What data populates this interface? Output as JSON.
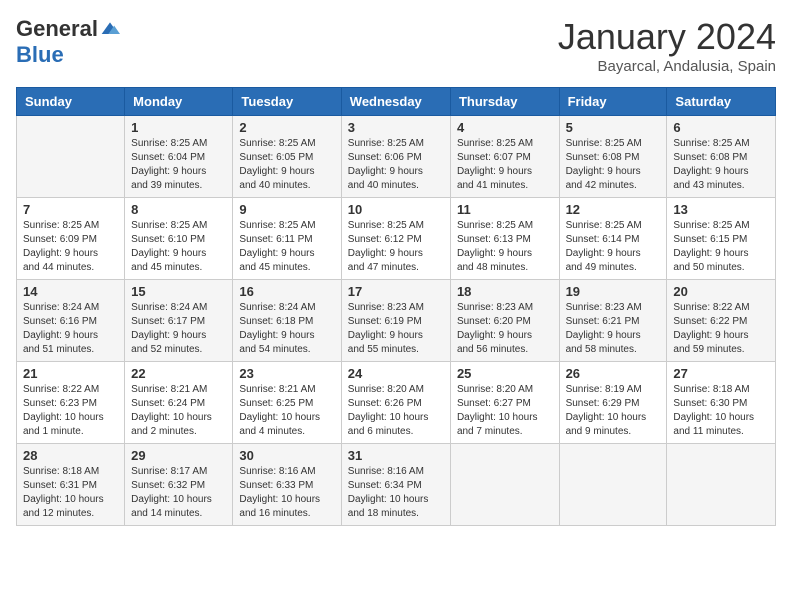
{
  "logo": {
    "general": "General",
    "blue": "Blue"
  },
  "header": {
    "month": "January 2024",
    "location": "Bayarcal, Andalusia, Spain"
  },
  "weekdays": [
    "Sunday",
    "Monday",
    "Tuesday",
    "Wednesday",
    "Thursday",
    "Friday",
    "Saturday"
  ],
  "weeks": [
    [
      {
        "day": "",
        "info": ""
      },
      {
        "day": "1",
        "info": "Sunrise: 8:25 AM\nSunset: 6:04 PM\nDaylight: 9 hours\nand 39 minutes."
      },
      {
        "day": "2",
        "info": "Sunrise: 8:25 AM\nSunset: 6:05 PM\nDaylight: 9 hours\nand 40 minutes."
      },
      {
        "day": "3",
        "info": "Sunrise: 8:25 AM\nSunset: 6:06 PM\nDaylight: 9 hours\nand 40 minutes."
      },
      {
        "day": "4",
        "info": "Sunrise: 8:25 AM\nSunset: 6:07 PM\nDaylight: 9 hours\nand 41 minutes."
      },
      {
        "day": "5",
        "info": "Sunrise: 8:25 AM\nSunset: 6:08 PM\nDaylight: 9 hours\nand 42 minutes."
      },
      {
        "day": "6",
        "info": "Sunrise: 8:25 AM\nSunset: 6:08 PM\nDaylight: 9 hours\nand 43 minutes."
      }
    ],
    [
      {
        "day": "7",
        "info": "Sunrise: 8:25 AM\nSunset: 6:09 PM\nDaylight: 9 hours\nand 44 minutes."
      },
      {
        "day": "8",
        "info": "Sunrise: 8:25 AM\nSunset: 6:10 PM\nDaylight: 9 hours\nand 45 minutes."
      },
      {
        "day": "9",
        "info": "Sunrise: 8:25 AM\nSunset: 6:11 PM\nDaylight: 9 hours\nand 45 minutes."
      },
      {
        "day": "10",
        "info": "Sunrise: 8:25 AM\nSunset: 6:12 PM\nDaylight: 9 hours\nand 47 minutes."
      },
      {
        "day": "11",
        "info": "Sunrise: 8:25 AM\nSunset: 6:13 PM\nDaylight: 9 hours\nand 48 minutes."
      },
      {
        "day": "12",
        "info": "Sunrise: 8:25 AM\nSunset: 6:14 PM\nDaylight: 9 hours\nand 49 minutes."
      },
      {
        "day": "13",
        "info": "Sunrise: 8:25 AM\nSunset: 6:15 PM\nDaylight: 9 hours\nand 50 minutes."
      }
    ],
    [
      {
        "day": "14",
        "info": "Sunrise: 8:24 AM\nSunset: 6:16 PM\nDaylight: 9 hours\nand 51 minutes."
      },
      {
        "day": "15",
        "info": "Sunrise: 8:24 AM\nSunset: 6:17 PM\nDaylight: 9 hours\nand 52 minutes."
      },
      {
        "day": "16",
        "info": "Sunrise: 8:24 AM\nSunset: 6:18 PM\nDaylight: 9 hours\nand 54 minutes."
      },
      {
        "day": "17",
        "info": "Sunrise: 8:23 AM\nSunset: 6:19 PM\nDaylight: 9 hours\nand 55 minutes."
      },
      {
        "day": "18",
        "info": "Sunrise: 8:23 AM\nSunset: 6:20 PM\nDaylight: 9 hours\nand 56 minutes."
      },
      {
        "day": "19",
        "info": "Sunrise: 8:23 AM\nSunset: 6:21 PM\nDaylight: 9 hours\nand 58 minutes."
      },
      {
        "day": "20",
        "info": "Sunrise: 8:22 AM\nSunset: 6:22 PM\nDaylight: 9 hours\nand 59 minutes."
      }
    ],
    [
      {
        "day": "21",
        "info": "Sunrise: 8:22 AM\nSunset: 6:23 PM\nDaylight: 10 hours\nand 1 minute."
      },
      {
        "day": "22",
        "info": "Sunrise: 8:21 AM\nSunset: 6:24 PM\nDaylight: 10 hours\nand 2 minutes."
      },
      {
        "day": "23",
        "info": "Sunrise: 8:21 AM\nSunset: 6:25 PM\nDaylight: 10 hours\nand 4 minutes."
      },
      {
        "day": "24",
        "info": "Sunrise: 8:20 AM\nSunset: 6:26 PM\nDaylight: 10 hours\nand 6 minutes."
      },
      {
        "day": "25",
        "info": "Sunrise: 8:20 AM\nSunset: 6:27 PM\nDaylight: 10 hours\nand 7 minutes."
      },
      {
        "day": "26",
        "info": "Sunrise: 8:19 AM\nSunset: 6:29 PM\nDaylight: 10 hours\nand 9 minutes."
      },
      {
        "day": "27",
        "info": "Sunrise: 8:18 AM\nSunset: 6:30 PM\nDaylight: 10 hours\nand 11 minutes."
      }
    ],
    [
      {
        "day": "28",
        "info": "Sunrise: 8:18 AM\nSunset: 6:31 PM\nDaylight: 10 hours\nand 12 minutes."
      },
      {
        "day": "29",
        "info": "Sunrise: 8:17 AM\nSunset: 6:32 PM\nDaylight: 10 hours\nand 14 minutes."
      },
      {
        "day": "30",
        "info": "Sunrise: 8:16 AM\nSunset: 6:33 PM\nDaylight: 10 hours\nand 16 minutes."
      },
      {
        "day": "31",
        "info": "Sunrise: 8:16 AM\nSunset: 6:34 PM\nDaylight: 10 hours\nand 18 minutes."
      },
      {
        "day": "",
        "info": ""
      },
      {
        "day": "",
        "info": ""
      },
      {
        "day": "",
        "info": ""
      }
    ]
  ]
}
